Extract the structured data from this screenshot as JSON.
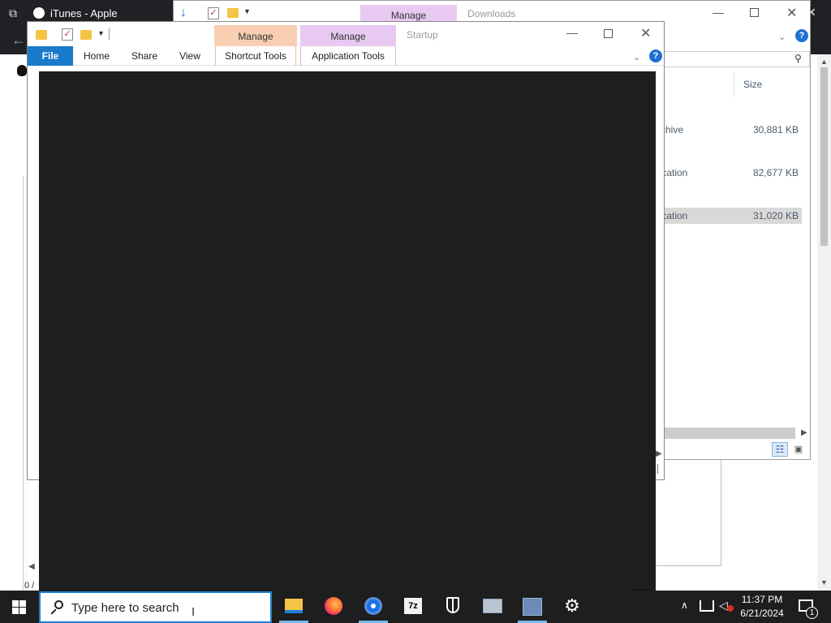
{
  "browser": {
    "tab_title": "iTunes - Apple",
    "status_text": "0 /"
  },
  "downloads_window": {
    "title": "Downloads",
    "context_tab": "Manage",
    "columns": {
      "type_header": "e",
      "size_header": "Size"
    },
    "rows": [
      {
        "type": "rchive",
        "size": "30,881 KB",
        "selected": false
      },
      {
        "type": "lication",
        "size": "82,677 KB",
        "selected": false
      },
      {
        "type": "lication",
        "size": "31,020 KB",
        "selected": true
      }
    ]
  },
  "startup_window": {
    "title": "Startup",
    "context_groups": [
      "Manage",
      "Manage"
    ],
    "ribbon_tabs": [
      "File",
      "Home",
      "Share",
      "View",
      "Shortcut Tools",
      "Application Tools"
    ]
  },
  "taskbar": {
    "search_placeholder": "Type here to search",
    "clock_time": "11:37 PM",
    "clock_date": "6/21/2024",
    "notification_count": "1",
    "apps": [
      "file-explorer",
      "firefox",
      "chrome",
      "7-zip",
      "security",
      "network-app",
      "grid-app",
      "settings"
    ]
  },
  "colors": {
    "taskbar_bg": "#1e1e1e",
    "file_tab": "#1979ca",
    "shortcut_tools_accent": "#f9cfb4",
    "application_tools_accent": "#e7c9f2",
    "overlay_panel": "#1e1e1e",
    "search_border": "#1f7fd8"
  }
}
